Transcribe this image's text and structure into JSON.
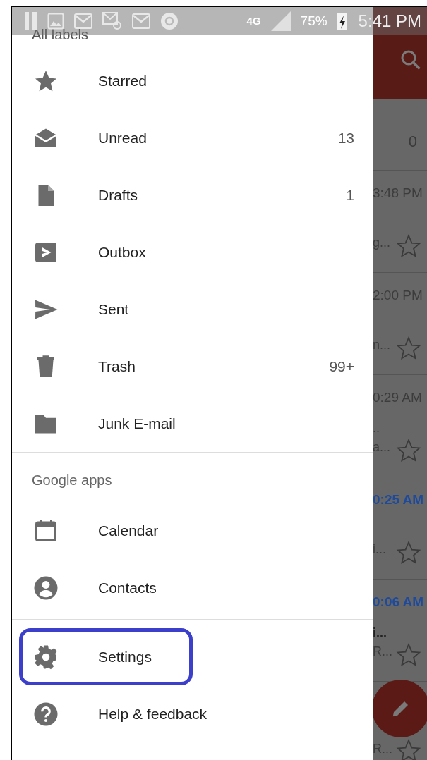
{
  "status_bar": {
    "network": "4G",
    "battery": "75%",
    "time": "5:41 PM"
  },
  "drawer": {
    "header": "All labels",
    "labels": [
      {
        "kind": "star",
        "name": "Starred"
      },
      {
        "kind": "envelope",
        "name": "Unread",
        "count": "13"
      },
      {
        "kind": "document",
        "name": "Drafts",
        "count": "1"
      },
      {
        "kind": "outbox",
        "name": "Outbox"
      },
      {
        "kind": "send",
        "name": "Sent"
      },
      {
        "kind": "trash",
        "name": "Trash",
        "count": "99+"
      },
      {
        "kind": "folder",
        "name": "Junk E-mail"
      }
    ],
    "section": "Google apps",
    "apps": [
      {
        "kind": "calendar",
        "name": "Calendar"
      },
      {
        "kind": "person",
        "name": "Contacts"
      }
    ],
    "footer": [
      {
        "kind": "gear",
        "name": "Settings",
        "highlighted": true
      },
      {
        "kind": "help",
        "name": "Help & feedback",
        "highlighted": false
      }
    ]
  },
  "inbox": {
    "count": "0",
    "emails": [
      {
        "time": "3:48 PM",
        "lines": [
          "g..."
        ],
        "unread": false
      },
      {
        "time": "2:00 PM",
        "lines": [
          "n..."
        ],
        "unread": false
      },
      {
        "time": "0:29 AM",
        "lines": [
          "..",
          "a..."
        ],
        "unread": false
      },
      {
        "time": "0:25 AM",
        "lines": [
          "i..."
        ],
        "unread": true
      },
      {
        "time": "0:06 AM",
        "lines": [
          "i...",
          "R..."
        ],
        "unread": true
      },
      {
        "lines": [
          "R..."
        ]
      }
    ]
  }
}
